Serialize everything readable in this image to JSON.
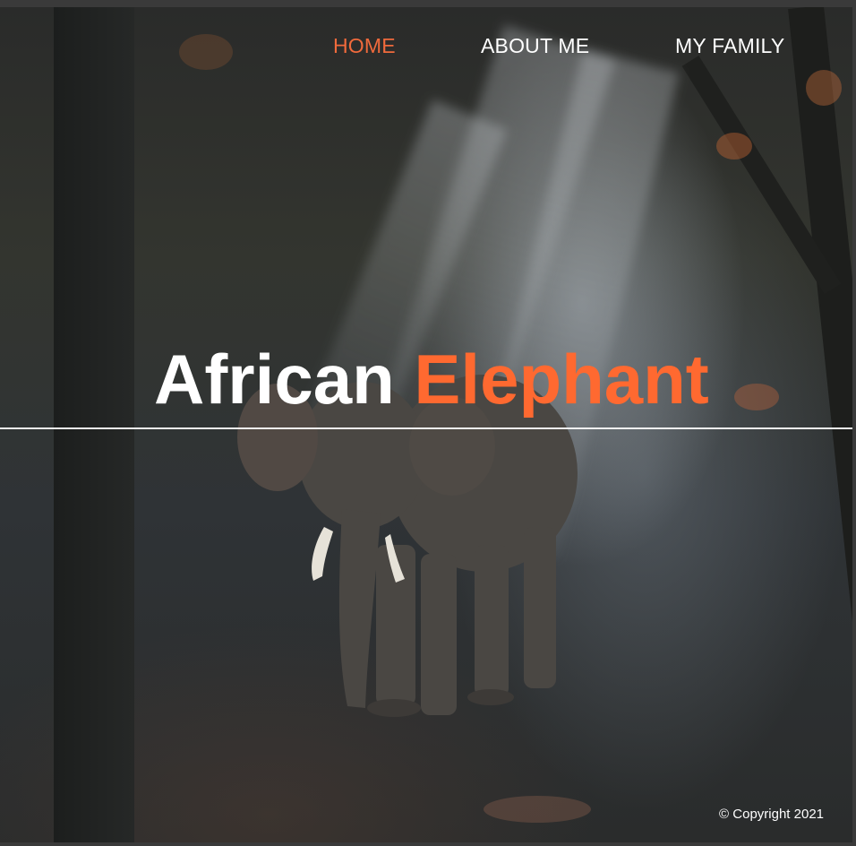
{
  "nav": {
    "items": [
      {
        "label": "HOME",
        "active": true
      },
      {
        "label": "ABOUT ME",
        "active": false
      },
      {
        "label": "MY FAMILY",
        "active": false
      }
    ]
  },
  "hero": {
    "title_part1": "African",
    "title_part2": "Elephant"
  },
  "footer": {
    "copyright": "© Copyright 2021"
  },
  "colors": {
    "accent": "#ff6930",
    "nav_active": "#f06a3c",
    "text": "#ffffff"
  }
}
